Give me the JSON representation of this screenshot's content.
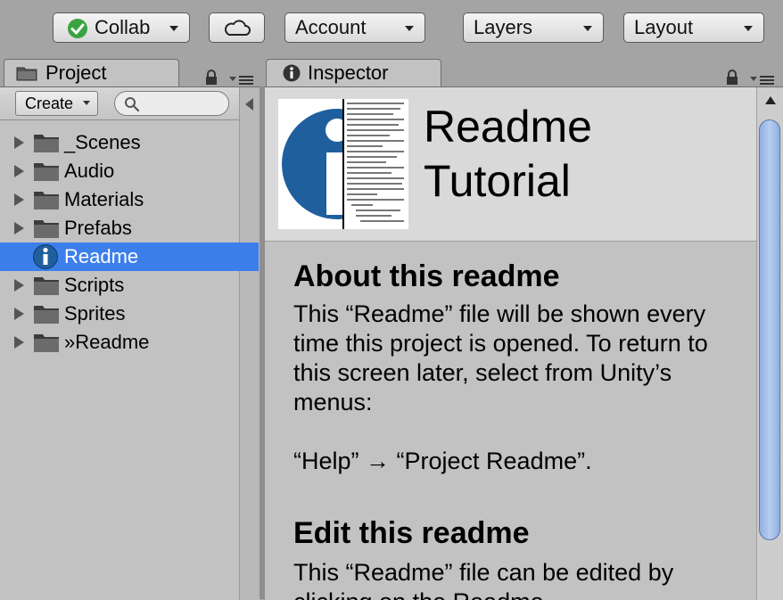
{
  "toolbar": {
    "collab_label": "Collab",
    "account_label": "Account",
    "layers_label": "Layers",
    "layout_label": "Layout"
  },
  "tabs": {
    "project_label": "Project",
    "inspector_label": "Inspector"
  },
  "project": {
    "create_label": "Create",
    "search_placeholder": "",
    "items": [
      {
        "label": "_Scenes",
        "icon": "folder-icon"
      },
      {
        "label": "Audio",
        "icon": "folder-icon"
      },
      {
        "label": "Materials",
        "icon": "folder-icon"
      },
      {
        "label": "Prefabs",
        "icon": "folder-icon"
      },
      {
        "label": "Readme",
        "icon": "info-icon",
        "selected": true
      },
      {
        "label": "Scripts",
        "icon": "folder-icon"
      },
      {
        "label": "Sprites",
        "icon": "folder-icon"
      },
      {
        "label": "»Readme",
        "icon": "folder-icon"
      }
    ]
  },
  "inspector": {
    "title_line1": "Readme",
    "title_line2": "Tutorial",
    "sections": [
      {
        "heading": "About this readme",
        "text": "This “Readme” file will be shown every time this project is opened. To return to this screen later, select from Unity’s menus:",
        "text2": "“Help” → “Project Readme”."
      },
      {
        "heading": "Edit this readme",
        "text": "This “Readme” file can be edited by clicking on the Readme"
      }
    ]
  },
  "colors": {
    "selection": "#3d7fea",
    "panel_bg": "#c2c2c2",
    "window_bg": "#a4a4a4",
    "accent_check": "#3aa341",
    "icon_blue": "#1f5f9e"
  }
}
